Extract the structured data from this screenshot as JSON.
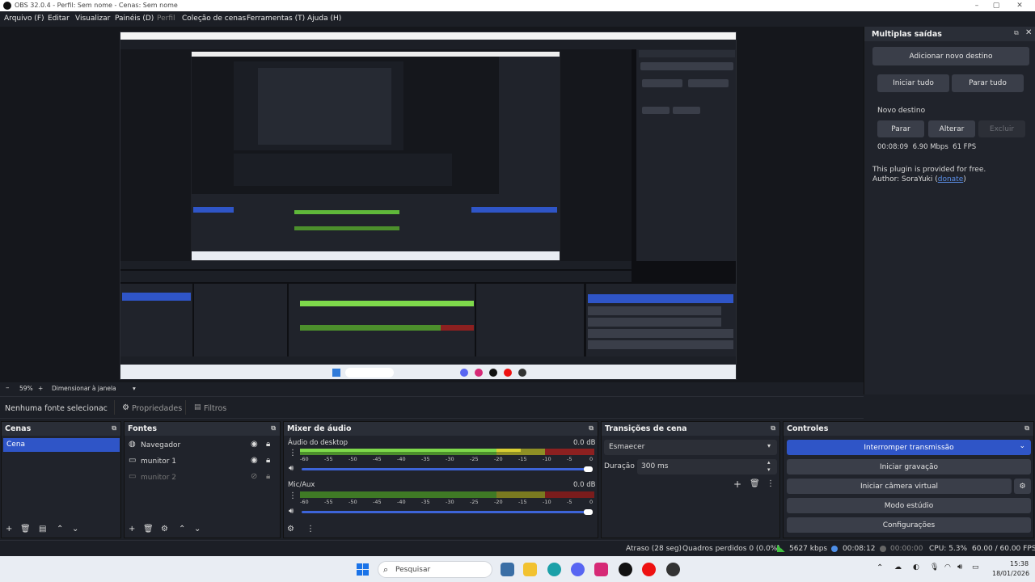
{
  "window": {
    "title": "OBS 32.0.4 - Perfil: Sem nome - Cenas: Sem nome"
  },
  "menu": [
    "Arquivo (F)",
    "Editar",
    "Visualizar",
    "Painéis (D)",
    "Perfil",
    "Coleção de cenas",
    "Ferramentas (T)",
    "Ajuda (H)"
  ],
  "multiple_outputs": {
    "title": "Multiplas saídas",
    "add_destination": "Adicionar novo destino",
    "start_all": "Iniciar tudo",
    "stop_all": "Parar tudo",
    "destination_name": "Novo destino",
    "stop": "Parar",
    "change": "Alterar",
    "delete": "Excluir",
    "stats": "00:08:09  6.90 Mbps  61 FPS",
    "plugin_note": "This plugin is provided for free.",
    "author_prefix": "Author: SoraYuki (",
    "donate": "donate",
    "author_suffix": ")"
  },
  "preview_bar": {
    "zoom": "59%",
    "mode": "Dimensionar à janela"
  },
  "source_bar": {
    "no_source": "Nenhuma fonte selecionac",
    "properties": "Propriedades",
    "filters": "Filtros"
  },
  "scenes": {
    "title": "Cenas",
    "items": [
      "Cena"
    ]
  },
  "sources": {
    "title": "Fontes",
    "items": [
      {
        "name": "Navegador",
        "visible": true
      },
      {
        "name": "munitor 1",
        "visible": true
      },
      {
        "name": "munitor 2",
        "visible": false
      }
    ]
  },
  "mixer": {
    "title": "Mixer de áudio",
    "channels": [
      {
        "name": "Áudio do desktop",
        "db": "0.0 dB"
      },
      {
        "name": "Mic/Aux",
        "db": "0.0 dB"
      }
    ],
    "scale": [
      "-60",
      "-55",
      "-50",
      "-45",
      "-40",
      "-35",
      "-30",
      "-25",
      "-20",
      "-15",
      "-10",
      "-5",
      "0"
    ]
  },
  "transitions": {
    "title": "Transições de cena",
    "selected": "Esmaecer",
    "duration_label": "Duração",
    "duration": "300 ms"
  },
  "controls": {
    "title": "Controles",
    "stream": "Interromper transmissão",
    "record": "Iniciar gravação",
    "vcam": "Iniciar câmera virtual",
    "studio": "Modo estúdio",
    "settings": "Configurações"
  },
  "status": {
    "delay": "Atraso (28 seg)",
    "dropped": "Quadros perdidos 0 (0.0%)",
    "bitrate": "5627 kbps",
    "stream_time": "00:08:12",
    "rec_time": "00:00:00",
    "cpu": "CPU: 5.3%",
    "fps": "60.00 / 60.00 FPS"
  },
  "taskbar": {
    "search": "Pesquisar",
    "time": "15:38",
    "date": "18/01/2026"
  },
  "colors": {
    "accent": "#2f55c7",
    "panel": "#20232b",
    "background": "#1c1f26"
  }
}
